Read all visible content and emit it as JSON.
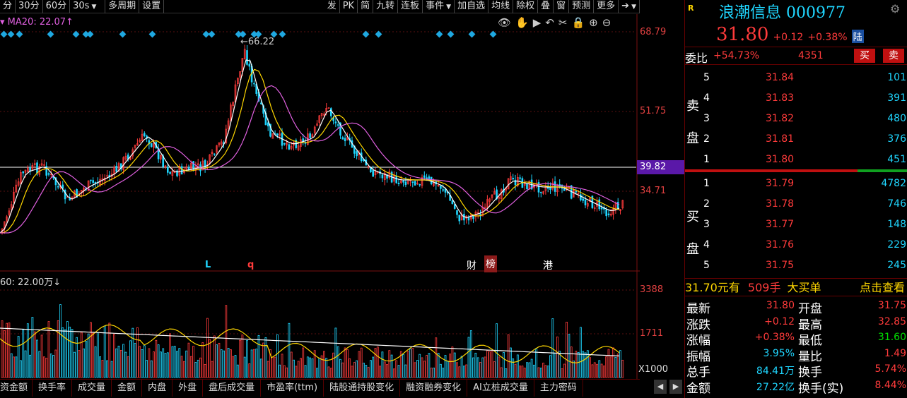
{
  "toolbar": {
    "items": [
      "分",
      "30分",
      "60分",
      "30s",
      "多周期",
      "设置"
    ],
    "right": [
      "发",
      "PK",
      "简",
      "九转",
      "连板",
      "事件",
      "加自选",
      "均线",
      "除权",
      "叠",
      "窗",
      "预测",
      "更多"
    ]
  },
  "chart": {
    "ma_label": "MA20: 22.07↑",
    "peak_label": "←66.22",
    "price_ticks": [
      "68.79",
      "51.75",
      "34.71"
    ],
    "ref_line": "39.82",
    "markers": [
      "L",
      "q",
      "财",
      "榜",
      "港"
    ],
    "vol_label": "60: 22.00万↓",
    "vol_ticks": [
      "3388",
      "1711"
    ],
    "vol_unit": "X1000"
  },
  "bottom_tabs": [
    "资金额",
    "换手率",
    "成交量",
    "金额",
    "内盘",
    "外盘",
    "盘后成交量",
    "市盈率(ttm)",
    "陆股通持股变化",
    "融资融券变化",
    "AI立桩成交量",
    "主力密码"
  ],
  "stock": {
    "r": "R",
    "name": "浪潮信息",
    "code": "000977",
    "price": "31.80",
    "change": "+0.12",
    "pct": "+0.38%",
    "tag": "陆",
    "wb_label": "委比",
    "wb_pct": "+54.73%",
    "wb_vol": "4351",
    "buy": "买",
    "sell": "卖"
  },
  "sell_side": {
    "label1": "卖",
    "label2": "盘",
    "rows": [
      {
        "lvl": "5",
        "price": "31.84",
        "vol": "101"
      },
      {
        "lvl": "4",
        "price": "31.83",
        "vol": "391"
      },
      {
        "lvl": "3",
        "price": "31.82",
        "vol": "480"
      },
      {
        "lvl": "2",
        "price": "31.81",
        "vol": "376"
      },
      {
        "lvl": "1",
        "price": "31.80",
        "vol": "451"
      }
    ]
  },
  "buy_side": {
    "label1": "买",
    "label2": "盘",
    "rows": [
      {
        "lvl": "1",
        "price": "31.79",
        "vol": "4782"
      },
      {
        "lvl": "2",
        "price": "31.78",
        "vol": "746"
      },
      {
        "lvl": "3",
        "price": "31.77",
        "vol": "148"
      },
      {
        "lvl": "4",
        "price": "31.76",
        "vol": "229"
      },
      {
        "lvl": "5",
        "price": "31.75",
        "vol": "245"
      }
    ]
  },
  "big_order": {
    "price": "31.70元有",
    "vol": "509手",
    "label": "大买单",
    "link": "点击查看"
  },
  "stats": [
    {
      "l1": "最新",
      "v1": "31.80",
      "l2": "开盘",
      "v2": "31.75"
    },
    {
      "l1": "涨跌",
      "v1": "+0.12",
      "l2": "最高",
      "v2": "32.85"
    },
    {
      "l1": "涨幅",
      "v1": "+0.38%",
      "l2": "最低",
      "v2": "31.60"
    },
    {
      "l1": "振幅",
      "v1": "3.95%",
      "l2": "量比",
      "v2": "1.49"
    },
    {
      "l1": "总手",
      "v1": "84.41万",
      "l2": "换手",
      "v2": "5.74%"
    },
    {
      "l1": "金额",
      "v1": "27.22亿",
      "l2": "换手(实)",
      "v2": "8.44%"
    }
  ],
  "colors": {
    "up": "#ff3b3b",
    "down": "#1fd6ff",
    "ma1": "#ffffff",
    "ma2": "#ffd700",
    "ma3": "#e060e0"
  }
}
